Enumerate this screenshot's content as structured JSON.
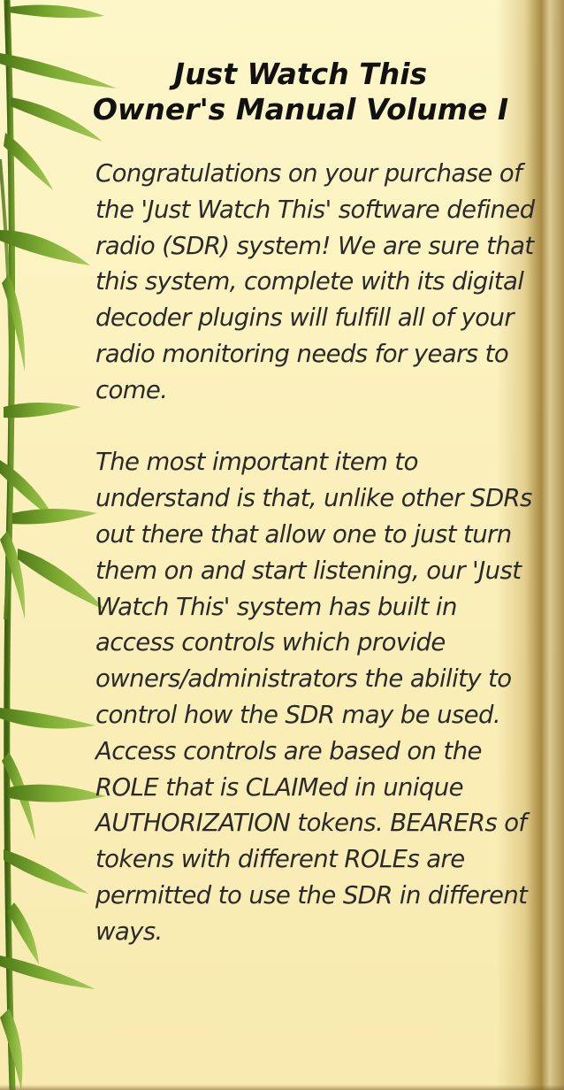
{
  "manual": {
    "title_line1": "Just Watch This",
    "title_line2": "Owner's Manual Volume I",
    "paragraphs": [
      "Congratulations on your purchase of the 'Just Watch This' software defined radio (SDR) system! We are sure that this system, complete with its digital decoder plugins will fulfill all of your radio monitoring needs for years to come.",
      "The most important item to understand is that, unlike other SDRs out there that allow one to just turn them on and start listening, our 'Just Watch This' system has built in access controls which provide owners/administrators the ability to control how the SDR may be used. Access controls are based on the ROLE that is CLAIMed in unique AUTHORIZATION tokens. BEARERs of tokens with different ROLEs are permitted to use the SDR in different ways."
    ]
  },
  "colors": {
    "paper": "#fbf0bb",
    "text": "#2a2a2a",
    "title": "#111111",
    "leaf": "#6f9a2a"
  },
  "icons": {
    "decoration": "bamboo-leaves-icon"
  }
}
